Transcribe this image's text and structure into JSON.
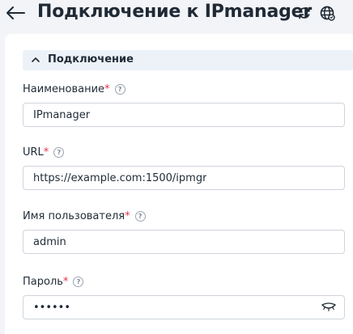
{
  "header": {
    "title": "Подключение к IPmanager",
    "back_icon": "arrow-left-icon",
    "refresh_icon": "refresh-icon",
    "globe_icon": "globe-icon"
  },
  "section": {
    "label": "Подключение",
    "expanded": true
  },
  "fields": [
    {
      "label": "Наименование",
      "required_mark": "*",
      "help": "?",
      "value": "IPmanager"
    },
    {
      "label": "URL",
      "required_mark": "*",
      "help": "?",
      "value": "https://example.com:1500/ipmgr"
    },
    {
      "label": "Имя пользователя",
      "required_mark": "*",
      "help": "?",
      "value": "admin"
    },
    {
      "label": "Пароль",
      "required_mark": "*",
      "help": "?",
      "value": "••••••"
    }
  ],
  "colors": {
    "accent_required": "#e5334b",
    "section_bg": "#edf2f9",
    "page_bg": "#f2f4f7"
  }
}
